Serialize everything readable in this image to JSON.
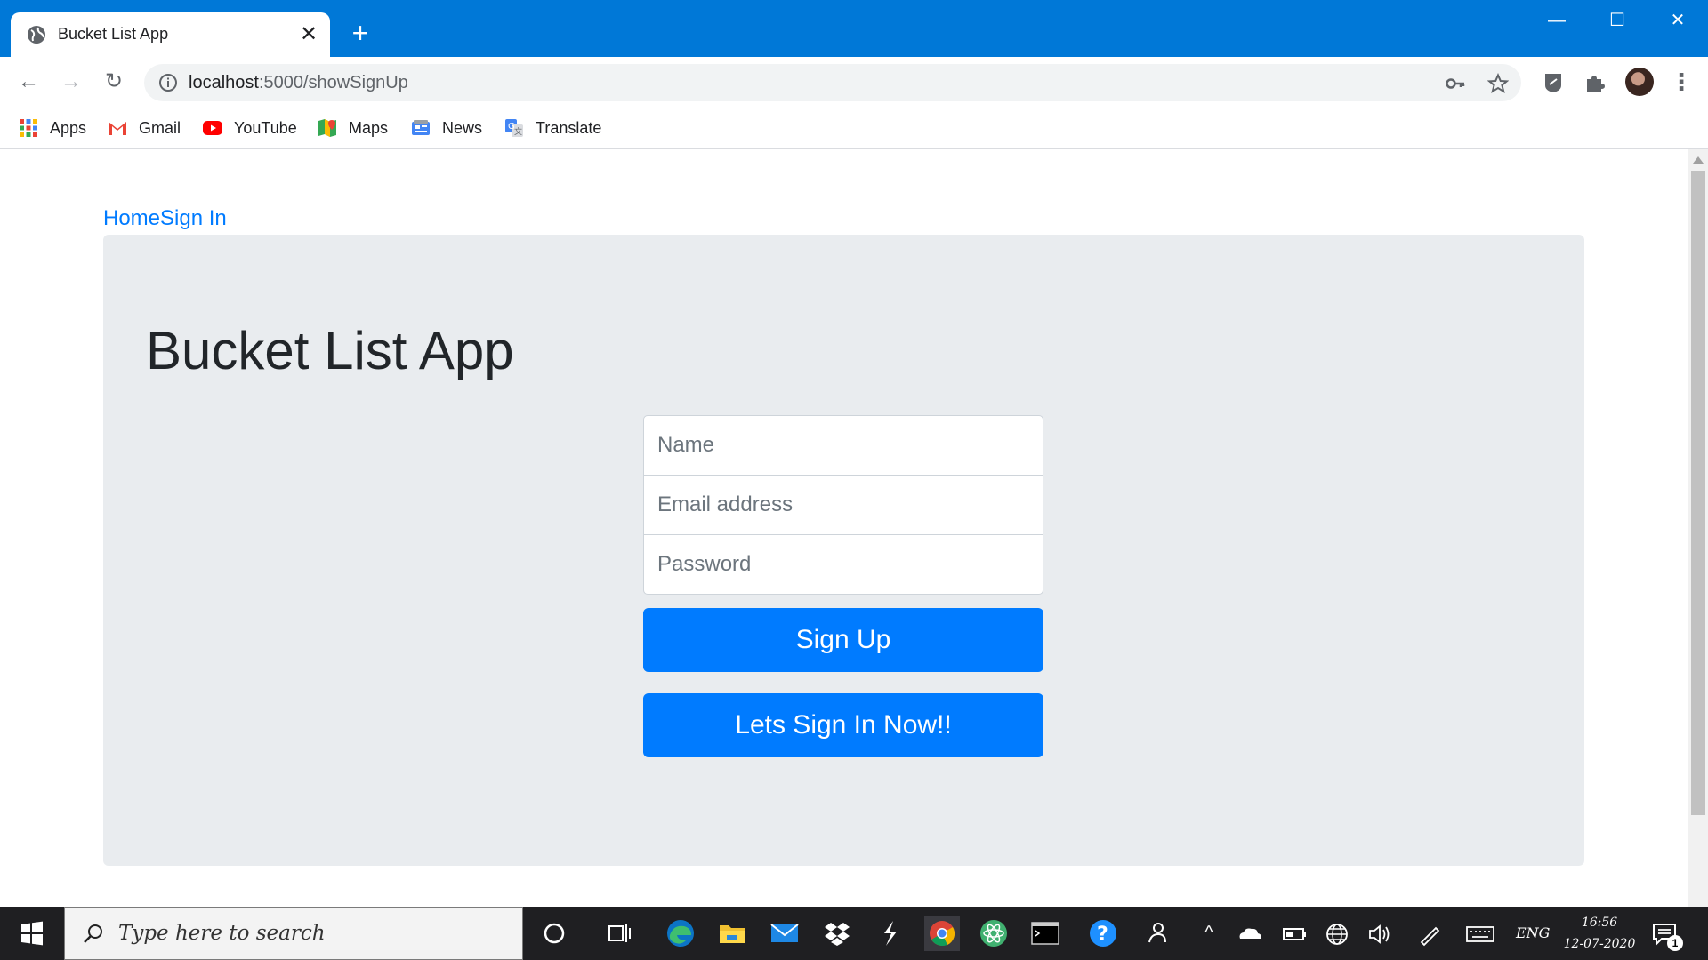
{
  "browser": {
    "tab_title": "Bucket List App",
    "url_host": "localhost",
    "url_path": ":5000/showSignUp",
    "bookmarks": [
      {
        "label": "Apps",
        "icon": "apps-grid-icon"
      },
      {
        "label": "Gmail",
        "icon": "gmail-icon"
      },
      {
        "label": "YouTube",
        "icon": "youtube-icon"
      },
      {
        "label": "Maps",
        "icon": "maps-icon"
      },
      {
        "label": "News",
        "icon": "news-icon"
      },
      {
        "label": "Translate",
        "icon": "translate-icon"
      }
    ]
  },
  "page": {
    "nav": {
      "home": "Home",
      "signin": "Sign In"
    },
    "heading": "Bucket List App",
    "form": {
      "name_placeholder": "Name",
      "email_placeholder": "Email address",
      "password_placeholder": "Password",
      "signup_label": "Sign Up",
      "signin_now_label": "Lets Sign In Now!!"
    }
  },
  "taskbar": {
    "search_placeholder": "Type here to search",
    "language": "ENG",
    "time": "16:56",
    "date": "12-07-2020",
    "notification_count": "1"
  },
  "colors": {
    "titlebar": "#0078d7",
    "primary": "#007bff",
    "jumbotron": "#e9ecef",
    "taskbar": "#1f1f22"
  }
}
